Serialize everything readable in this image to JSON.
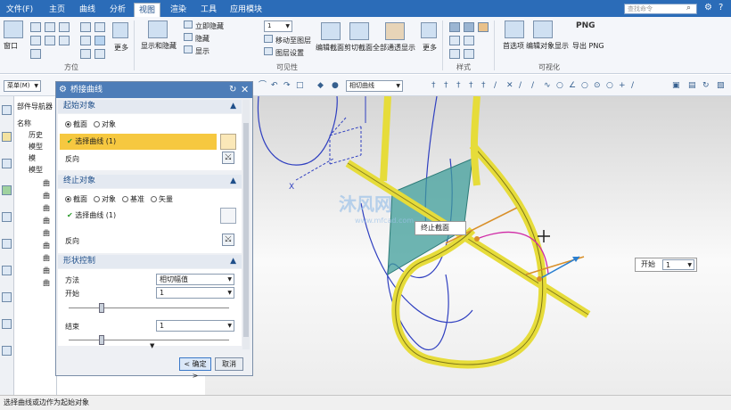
{
  "tabs": [
    {
      "label": "文件(F)"
    },
    {
      "label": "主页"
    },
    {
      "label": "曲线"
    },
    {
      "label": "分析"
    },
    {
      "label": "视图"
    },
    {
      "label": "渲染"
    },
    {
      "label": "工具"
    },
    {
      "label": "应用模块"
    }
  ],
  "search": {
    "placeholder": "查找命令"
  },
  "ribbon": {
    "groups": [
      "方位",
      "可见性",
      "样式",
      "可视化"
    ],
    "window_label": "窗口",
    "more_label": "更多",
    "show_hide": "显示和隐藏",
    "immediate_hide": "立即隐藏",
    "hide": "隐藏",
    "show": "显示",
    "layer_value": "1",
    "move_to_layer": "移动至图层",
    "layer_settings": "图层设置",
    "edit_section": "编辑截面",
    "clip_section": "剪切截面",
    "show_all_transparent": "全部通透显示",
    "more2": "更多",
    "preferences": "首选项",
    "edit_object_display": "编辑对象显示",
    "png_icon_text": "PNG",
    "export_png": "导出 PNG"
  },
  "toolbar2": {
    "menu_label": "菜单(M)",
    "filter_value": "相切曲线"
  },
  "navigator": {
    "title": "部件导航器",
    "column_name": "名称",
    "items": [
      "历史",
      "模型",
      "模",
      "模型",
      "曲",
      "曲",
      "曲",
      "曲",
      "曲",
      "曲",
      "曲",
      "曲",
      "曲"
    ]
  },
  "dialog": {
    "title": "桥接曲线",
    "start": {
      "header": "起始对象",
      "radio_section": "截面",
      "radio_object": "对象",
      "select_label": "选择曲线 (1)",
      "reverse": "反向"
    },
    "end": {
      "header": "终止对象",
      "radio_section": "截面",
      "radio_object": "对象",
      "radio_datum": "基准",
      "radio_vector": "矢量",
      "select_label": "选择曲线 (1)",
      "reverse": "反向"
    },
    "shape": {
      "header": "形状控制",
      "method_label": "方法",
      "method_value": "相切幅值",
      "start_label": "开始",
      "start_value": "1",
      "end_label": "结束",
      "end_value": "1"
    },
    "ok_label": "< 确定 >",
    "cancel_label": "取消"
  },
  "viewport": {
    "end_section_label": "终止截面",
    "start_label": "开始",
    "start_value": "1",
    "axis_x": "X",
    "watermark": "沐风网",
    "watermark_url": "www.mfcad.com"
  },
  "status": {
    "text": "选择曲线或边作为起始对象"
  },
  "colors": {
    "tab_bar": "#2b6cb8",
    "dialog_title": "#4e7db8",
    "curve_yellow": "#e6dc3a",
    "plane": "#3f9e9a",
    "bridge": "#d02aa6"
  }
}
